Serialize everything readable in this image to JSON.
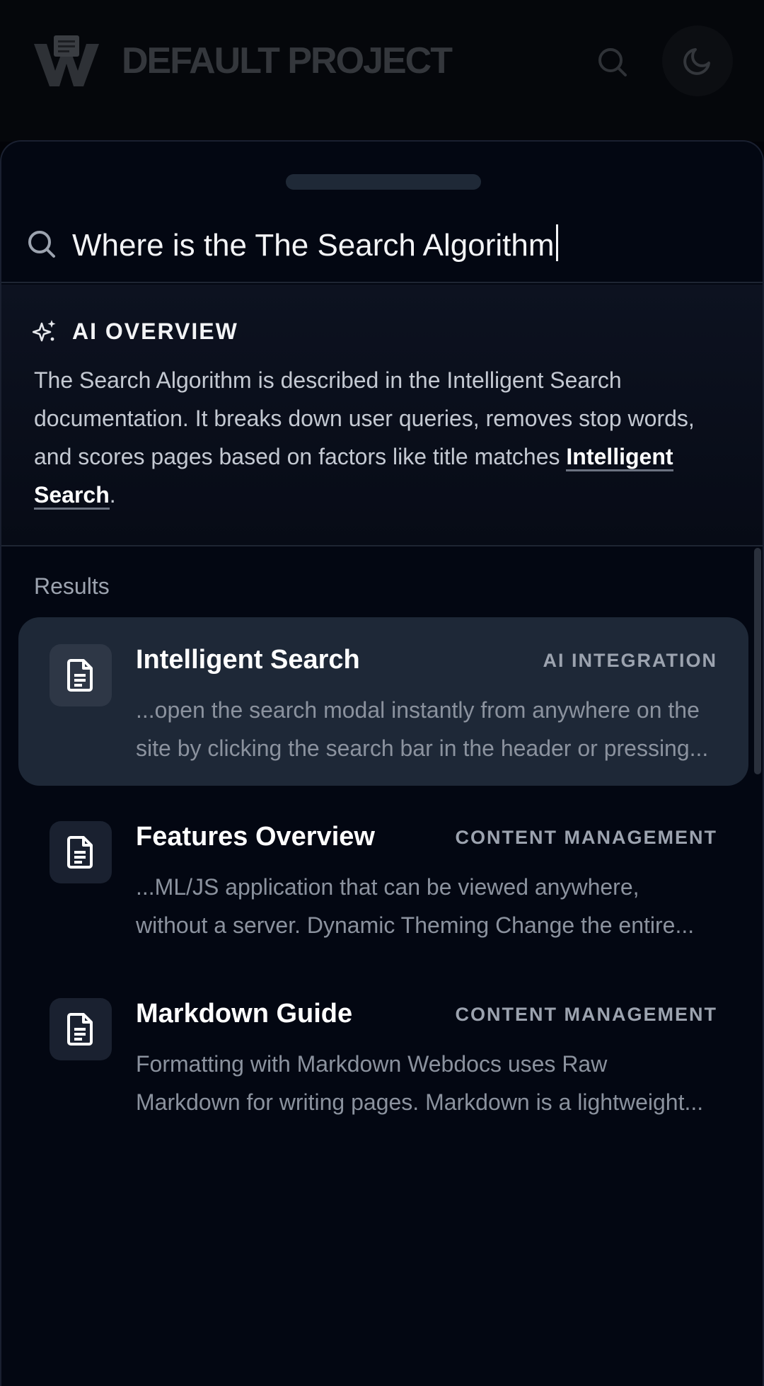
{
  "header": {
    "project_title": "DEFAULT PROJECT",
    "logo_icon": "webdocs-logo-icon",
    "search_icon": "search-icon",
    "theme_icon": "moon-icon"
  },
  "search": {
    "query": "Where is the The Search Algorithm",
    "icon": "search-icon"
  },
  "ai_overview": {
    "title": "AI OVERVIEW",
    "icon": "sparkles-icon",
    "text": "The Search Algorithm is described in the Intelligent Search documentation. It breaks down user queries, removes stop words, and scores pages based on factors like title matches ",
    "link_label": "Intelligent Search",
    "text_end": "."
  },
  "results": {
    "label": "Results",
    "items": [
      {
        "title": "Intelligent Search",
        "category": "AI INTEGRATION",
        "snippet": "...open the search modal instantly from anywhere on the site by clicking the search bar in the header or pressing...",
        "icon": "document-icon",
        "active": true
      },
      {
        "title": "Features Overview",
        "category": "CONTENT MANAGEMENT",
        "snippet": "...ML/JS application that can be viewed anywhere, without a server. Dynamic Theming Change the entire...",
        "icon": "document-icon",
        "active": false
      },
      {
        "title": "Markdown Guide",
        "category": "CONTENT MANAGEMENT",
        "snippet": "Formatting with Markdown Webdocs uses Raw Markdown for writing pages. Markdown is a lightweight...",
        "icon": "document-icon",
        "active": false
      }
    ]
  },
  "colors": {
    "background": "#030712",
    "active_result": "#1e2837",
    "text_primary": "#ffffff",
    "text_muted": "#8b929e"
  }
}
